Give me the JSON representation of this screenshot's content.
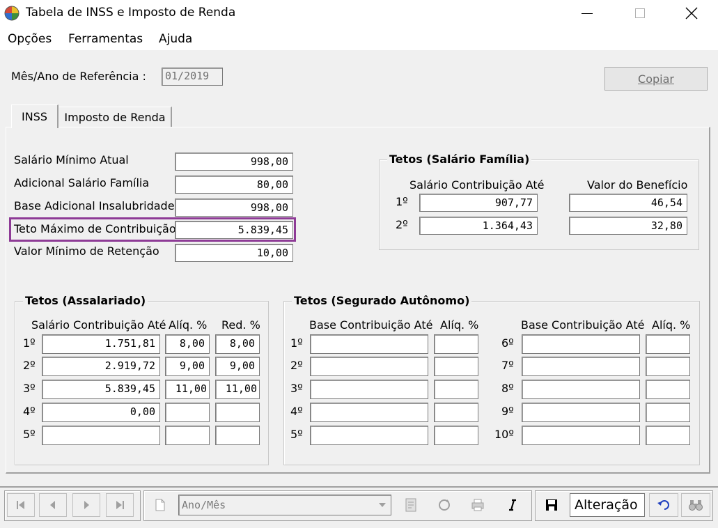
{
  "window": {
    "title": "Tabela de INSS e Imposto de Renda",
    "minimize": "—",
    "maximize": "☐",
    "close": "✕"
  },
  "menu": [
    "Opções",
    "Ferramentas",
    "Ajuda"
  ],
  "reference": {
    "label": "Mês/Ano de Referência :",
    "value": "01/2019",
    "copy_button": "Copiar"
  },
  "tabs": [
    {
      "label": "INSS",
      "active": true
    },
    {
      "label": "Imposto de Renda",
      "active": false
    }
  ],
  "general": [
    {
      "label": "Salário Mínimo Atual",
      "value": "998,00"
    },
    {
      "label": "Adicional Salário Família",
      "value": "80,00"
    },
    {
      "label": "Base Adicional Insalubridade",
      "value": "998,00"
    },
    {
      "label": "Teto Máximo de Contribuição",
      "value": "5.839,45",
      "highlighted": true
    },
    {
      "label": "Valor Mínimo de Retenção",
      "value": "10,00"
    }
  ],
  "salario_familia": {
    "title": "Tetos (Salário Família)",
    "col1": "Salário Contribuição Até",
    "col2": "Valor do Benefício",
    "rows": [
      {
        "label": "1º",
        "base": "907,77",
        "value": "46,54"
      },
      {
        "label": "2º",
        "base": "1.364,43",
        "value": "32,80"
      }
    ]
  },
  "assalariado": {
    "title": "Tetos (Assalariado)",
    "col1": "Salário Contribuição Até",
    "col2": "Alíq. %",
    "col3": "Red. %",
    "rows": [
      {
        "label": "1º",
        "base": "1.751,81",
        "aliq": "8,00",
        "red": "8,00"
      },
      {
        "label": "2º",
        "base": "2.919,72",
        "aliq": "9,00",
        "red": "9,00"
      },
      {
        "label": "3º",
        "base": "5.839,45",
        "aliq": "11,00",
        "red": "11,00"
      },
      {
        "label": "4º",
        "base": "0,00",
        "aliq": "",
        "red": ""
      },
      {
        "label": "5º",
        "base": "",
        "aliq": "",
        "red": ""
      }
    ]
  },
  "autonomo": {
    "title": "Tetos (Segurado Autônomo)",
    "col1": "Base Contribuição Até",
    "col2": "Alíq. %",
    "rows": [
      {
        "label": "1º",
        "base": "",
        "aliq": ""
      },
      {
        "label": "2º",
        "base": "",
        "aliq": ""
      },
      {
        "label": "3º",
        "base": "",
        "aliq": ""
      },
      {
        "label": "4º",
        "base": "",
        "aliq": ""
      },
      {
        "label": "5º",
        "base": "",
        "aliq": ""
      },
      {
        "label": "6º",
        "base": "",
        "aliq": ""
      },
      {
        "label": "7º",
        "base": "",
        "aliq": ""
      },
      {
        "label": "8º",
        "base": "",
        "aliq": ""
      },
      {
        "label": "9º",
        "base": "",
        "aliq": ""
      },
      {
        "label": "10º",
        "base": "",
        "aliq": ""
      }
    ]
  },
  "toolbar": {
    "combo_placeholder": "Ano/Mês",
    "mode": "Alteração",
    "icons": [
      "first-icon",
      "prev-icon",
      "next-icon",
      "last-icon",
      "new-document-icon",
      "report-icon",
      "refresh-icon",
      "print-icon",
      "italic-icon",
      "save-icon",
      "undo-icon",
      "binoculars-icon"
    ]
  },
  "colors": {
    "highlight": "#8e3b96",
    "background": "#f0f0f0"
  }
}
